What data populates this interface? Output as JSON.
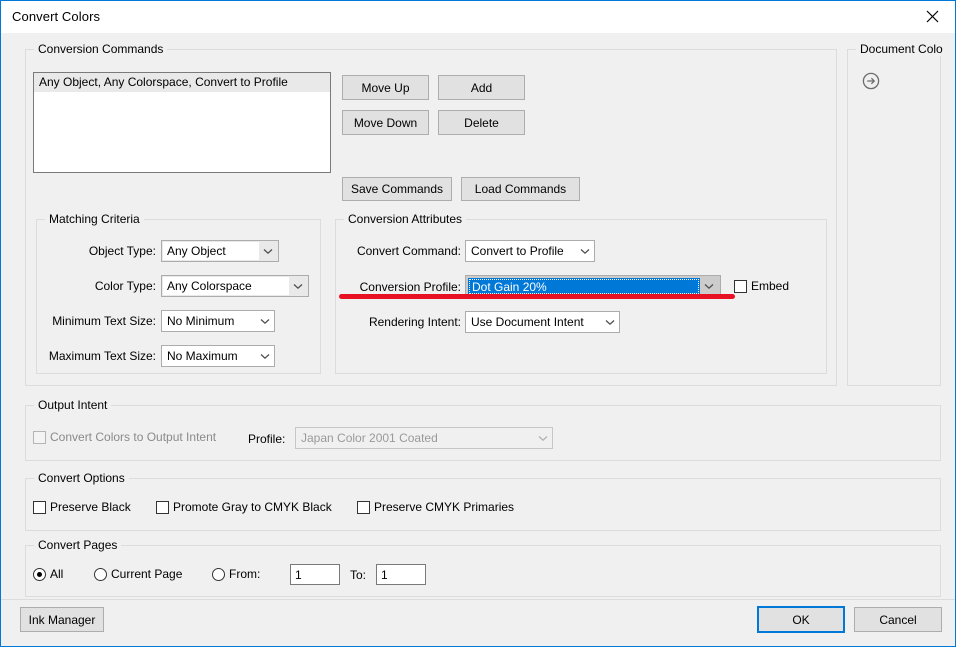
{
  "window": {
    "title": "Convert Colors",
    "close_icon": "close-icon",
    "accent_color": "#0078d7",
    "annotation_color": "#e81123"
  },
  "conversion_commands": {
    "legend": "Conversion Commands",
    "items": [
      {
        "label": "Any Object, Any Colorspace, Convert to Profile",
        "selected": true
      }
    ],
    "buttons": {
      "move_up": "Move Up",
      "add": "Add",
      "move_down": "Move Down",
      "delete": "Delete",
      "save_commands": "Save Commands",
      "load_commands": "Load Commands"
    }
  },
  "matching_criteria": {
    "legend": "Matching Criteria",
    "object_type": {
      "label": "Object Type:",
      "value": "Any Object"
    },
    "color_type": {
      "label": "Color Type:",
      "value": "Any Colorspace"
    },
    "minimum_text_size": {
      "label": "Minimum Text Size:",
      "value": "No Minimum"
    },
    "maximum_text_size": {
      "label": "Maximum Text Size:",
      "value": "No Maximum"
    }
  },
  "conversion_attributes": {
    "legend": "Conversion Attributes",
    "convert_command": {
      "label": "Convert Command:",
      "value": "Convert to Profile"
    },
    "conversion_profile": {
      "label": "Conversion Profile:",
      "value": "Dot Gain 20%",
      "focused": true
    },
    "embed": {
      "label": "Embed",
      "checked": false
    },
    "rendering_intent": {
      "label": "Rendering Intent:",
      "value": "Use Document Intent"
    }
  },
  "document_colors": {
    "legend": "Document Colo",
    "arrow_icon": "arrow-right-circle-icon"
  },
  "output_intent": {
    "legend": "Output Intent",
    "convert_checkbox": {
      "label": "Convert Colors to Output Intent",
      "checked": false,
      "disabled": true
    },
    "profile": {
      "label": "Profile:",
      "value": "Japan Color 2001 Coated",
      "disabled": true
    }
  },
  "convert_options": {
    "legend": "Convert Options",
    "items": [
      {
        "label": "Preserve Black",
        "checked": false
      },
      {
        "label": "Promote Gray to CMYK Black",
        "checked": false
      },
      {
        "label": "Preserve CMYK Primaries",
        "checked": false
      }
    ]
  },
  "convert_pages": {
    "legend": "Convert Pages",
    "all": {
      "label": "All",
      "checked": true
    },
    "current_page": {
      "label": "Current Page",
      "checked": false
    },
    "from_radio": {
      "label": "From:",
      "checked": false
    },
    "from_value": "1",
    "to_label": "To:",
    "to_value": "1"
  },
  "footer": {
    "ink_manager": "Ink Manager",
    "ok": "OK",
    "cancel": "Cancel"
  }
}
